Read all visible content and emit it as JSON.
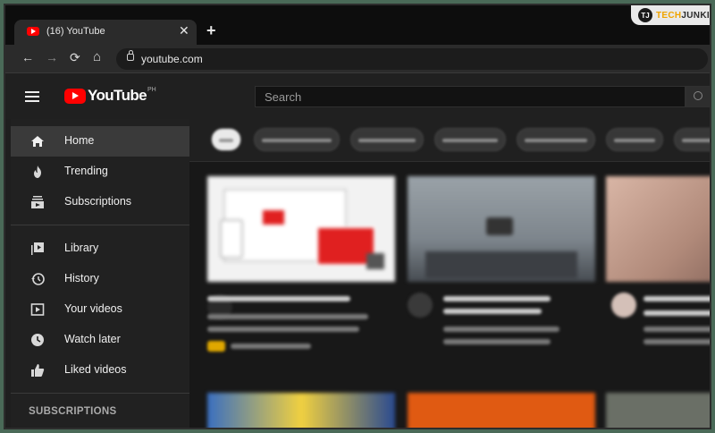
{
  "browser": {
    "tab_title": "(16) YouTube",
    "tab_close": "✕",
    "new_tab": "+",
    "url": "youtube.com",
    "nav": {
      "back": "←",
      "forward": "→",
      "reload": "⟳",
      "home": "⌂"
    }
  },
  "watermark": {
    "logo": "TJ",
    "text_a": "TECH",
    "text_b": "JUNKIE"
  },
  "youtube": {
    "logo_text": "YouTube",
    "logo_region": "PH",
    "search_placeholder": "Search"
  },
  "sidebar": {
    "items": [
      {
        "label": "Home",
        "icon": "home-icon",
        "active": true
      },
      {
        "label": "Trending",
        "icon": "flame-icon",
        "active": false
      },
      {
        "label": "Subscriptions",
        "icon": "subscriptions-icon",
        "active": false
      },
      {
        "label": "Library",
        "icon": "library-icon",
        "active": false
      },
      {
        "label": "History",
        "icon": "history-icon",
        "active": false
      },
      {
        "label": "Your videos",
        "icon": "your-videos-icon",
        "active": false
      },
      {
        "label": "Watch later",
        "icon": "clock-icon",
        "active": false
      },
      {
        "label": "Liked videos",
        "icon": "thumbs-up-icon",
        "active": false
      }
    ],
    "subscriptions_heading": "SUBSCRIPTIONS"
  },
  "colors": {
    "brand_red": "#ff0000",
    "sidebar_bg": "#212121",
    "active_item_bg": "#3a3a3a",
    "frame_bg": "#4a6a58"
  }
}
